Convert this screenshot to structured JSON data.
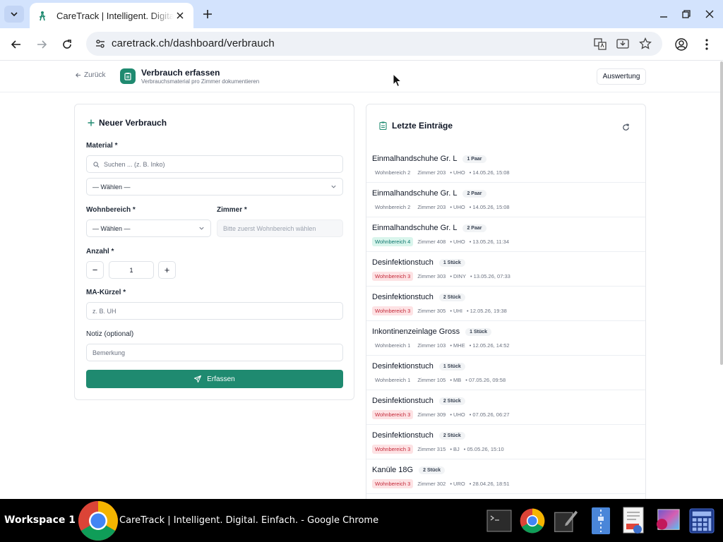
{
  "browser": {
    "tab_title": "CareTrack | Intelligent. Digital. Einfach.",
    "url": "caretrack.ch/dashboard/verbrauch"
  },
  "header": {
    "back_label": "Zurück",
    "title": "Verbrauch erfassen",
    "subtitle": "Verbrauchsmaterial pro Zimmer dokumentieren",
    "report_button": "Auswertung"
  },
  "form": {
    "title": "Neuer Verbrauch",
    "material_label": "Material *",
    "material_search_placeholder": "Suchen ... (z. B. Inko)",
    "material_select": "— Wählen —",
    "wohnbereich_label": "Wohnbereich *",
    "wohnbereich_select": "— Wählen —",
    "zimmer_label": "Zimmer *",
    "zimmer_placeholder": "Bitte zuerst Wohnbereich wählen",
    "anzahl_label": "Anzahl *",
    "anzahl_minus": "−",
    "anzahl_value": "1",
    "anzahl_plus": "+",
    "kuerzel_label": "MA-Kürzel *",
    "kuerzel_placeholder": "z. B. UH",
    "notiz_label": "Notiz (optional)",
    "notiz_placeholder": "Bemerkung",
    "submit_label": "Erfassen"
  },
  "entries": {
    "title": "Letzte Einträge",
    "items": [
      {
        "name": "Einmalhandschuhe Gr. L",
        "qty": "1 Paar",
        "wohnbereich": "Wohnbereich 2",
        "wb_color": "none",
        "zimmer": "Zimmer 203",
        "kuerzel": "• UHO",
        "time": "• 14.05.26, 15:08"
      },
      {
        "name": "Einmalhandschuhe Gr. L",
        "qty": "2 Paar",
        "wohnbereich": "Wohnbereich 2",
        "wb_color": "none",
        "zimmer": "Zimmer 203",
        "kuerzel": "• UHO",
        "time": "• 14.05.26, 15:08"
      },
      {
        "name": "Einmalhandschuhe Gr. L",
        "qty": "2 Paar",
        "wohnbereich": "Wohnbereich 4",
        "wb_color": "green",
        "zimmer": "Zimmer 408",
        "kuerzel": "• UHO",
        "time": "• 13.05.26, 11:34"
      },
      {
        "name": "Desinfektionstuch",
        "qty": "1 Stück",
        "wohnbereich": "Wohnbereich 3",
        "wb_color": "red",
        "zimmer": "Zimmer 303",
        "kuerzel": "• DINY",
        "time": "• 13.05.26, 07:33"
      },
      {
        "name": "Desinfektionstuch",
        "qty": "2 Stück",
        "wohnbereich": "Wohnbereich 3",
        "wb_color": "red",
        "zimmer": "Zimmer 305",
        "kuerzel": "• UHI",
        "time": "• 12.05.26, 19:38"
      },
      {
        "name": "Inkontinenzeinlage Gross",
        "qty": "1 Stück",
        "wohnbereich": "Wohnbereich 1",
        "wb_color": "none",
        "zimmer": "Zimmer 103",
        "kuerzel": "• MHE",
        "time": "• 12.05.26, 14:52"
      },
      {
        "name": "Desinfektionstuch",
        "qty": "1 Stück",
        "wohnbereich": "Wohnbereich 1",
        "wb_color": "none",
        "zimmer": "Zimmer 105",
        "kuerzel": "• MB",
        "time": "• 07.05.26, 09:58"
      },
      {
        "name": "Desinfektionstuch",
        "qty": "2 Stück",
        "wohnbereich": "Wohnbereich 3",
        "wb_color": "red",
        "zimmer": "Zimmer 309",
        "kuerzel": "• UHO",
        "time": "• 07.05.26, 06:27"
      },
      {
        "name": "Desinfektionstuch",
        "qty": "2 Stück",
        "wohnbereich": "Wohnbereich 3",
        "wb_color": "red",
        "zimmer": "Zimmer 315",
        "kuerzel": "• BJ",
        "time": "• 05.05.26, 15:10"
      },
      {
        "name": "Kanüle 18G",
        "qty": "2 Stück",
        "wohnbereich": "Wohnbereich 3",
        "wb_color": "red",
        "zimmer": "Zimmer 302",
        "kuerzel": "• URO",
        "time": "• 28.04.26, 18:51"
      }
    ]
  },
  "taskbar": {
    "workspace": "Workspace 1",
    "window_title": "CareTrack | Intelligent. Digital. Einfach. - Google Chrome"
  },
  "colors": {
    "accent": "#1f8a70",
    "badge_green_bg": "#d9f5ec",
    "badge_red_bg": "#fde2e4",
    "tabstrip": "#d3e3fd"
  }
}
